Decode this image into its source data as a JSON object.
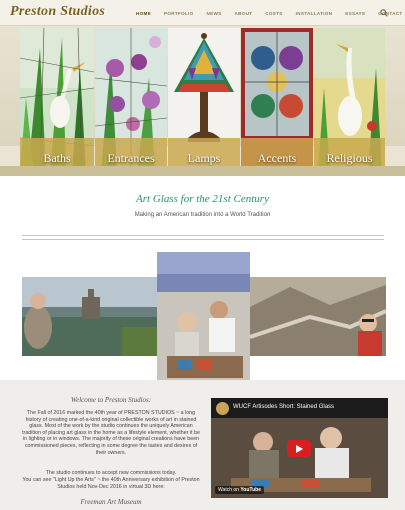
{
  "header": {
    "logo": "Preston Studios",
    "nav": [
      "HOME",
      "PORTFOLIO",
      "NEWS",
      "ABOUT",
      "COSTS",
      "INSTALLATION",
      "ESSAYS",
      "CONTACT"
    ],
    "search_icon": "search-icon"
  },
  "banner": {
    "panels": [
      "Baths",
      "Entrances",
      "Lamps",
      "Accents",
      "Religious"
    ]
  },
  "tagline": {
    "title": "Art Glass for the 21st Century",
    "subtitle": "Making an American tradition into a World Tradition"
  },
  "welcome": {
    "title": "Welcome to Preston Studios:",
    "paragraph1": "The Fall of 2016 marked the 40th year of PRESTON STUDIOS ~ a long history of creating one-of-a-kind original collectible works of art in stained glass.  Most of the work by the studio continues the uniquely American tradition of placing art glass in the home as a lifestyle element, whether it be in lighting or in windows.  The majority of these original creations have been commissioned pieces, reflecting in some degree the tastes and desires of their owners.",
    "paragraph2": "The studio continues to accept new commissions today.",
    "paragraph3": "You can see \"Light Up the Arts\" ~ the 40th Anniversary exhibition of Preston Studios held Nov-Dec 2016 in virtual 3D here:",
    "signature": "Freeman Art Museum"
  },
  "video": {
    "title": "WUCF Artisodes Short: Stained Glass",
    "watch_label": "Watch on",
    "platform": "YouTube"
  }
}
